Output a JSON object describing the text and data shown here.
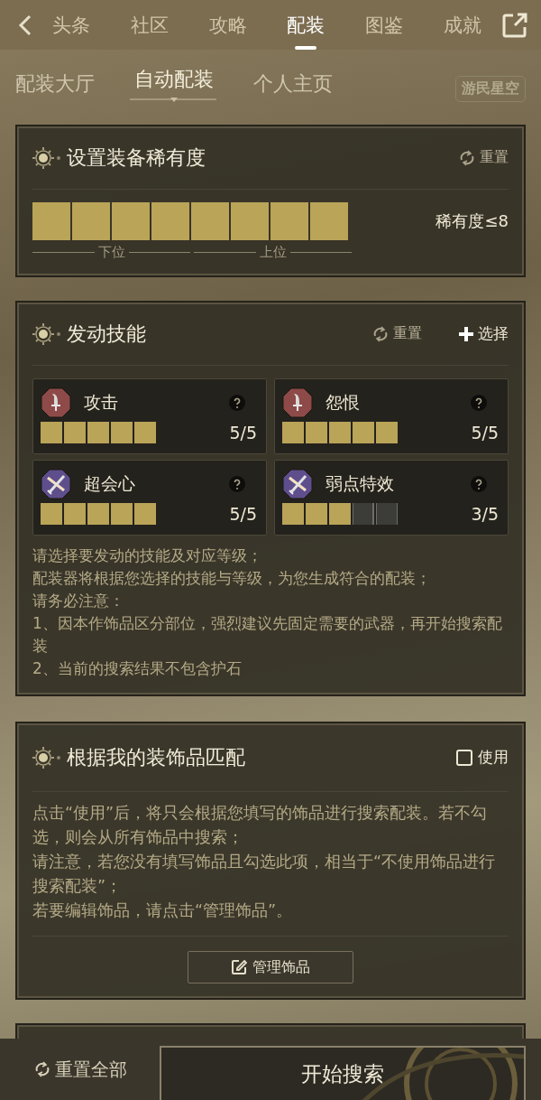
{
  "nav": {
    "tabs": [
      {
        "label": "头条",
        "selected": false
      },
      {
        "label": "社区",
        "selected": false
      },
      {
        "label": "攻略",
        "selected": false
      },
      {
        "label": "配装",
        "selected": true
      },
      {
        "label": "图鉴",
        "selected": false
      },
      {
        "label": "成就",
        "selected": false
      }
    ]
  },
  "subtabs": [
    {
      "label": "配装大厅",
      "selected": false
    },
    {
      "label": "自动配装",
      "selected": true
    },
    {
      "label": "个人主页",
      "selected": false
    }
  ],
  "brand": "游民星空",
  "rarity": {
    "title": "设置装备稀有度",
    "reset": "重置",
    "level": 1,
    "reading": "稀有度≤8",
    "scale": [
      "下位",
      "上位"
    ]
  },
  "skills": {
    "title": "发动技能",
    "reset": "重置",
    "select": "选择",
    "items": [
      {
        "name": "攻击",
        "kind": "blade",
        "color": "#8e4a48",
        "level": 1,
        "reading": "5/5"
      },
      {
        "name": "怨恨",
        "kind": "blade",
        "color": "#8e4a48",
        "level": 1,
        "reading": "5/5"
      },
      {
        "name": "超会心",
        "kind": "swords",
        "color": "#5f4e8c",
        "level": 1,
        "reading": "5/5"
      },
      {
        "name": "弱点特效",
        "kind": "swords",
        "color": "#5f4e8c",
        "level": 0.6,
        "reading": "3/5"
      }
    ],
    "notes": [
      "请选择要发动的技能及对应等级；",
      "配装器将根据您选择的技能与等级，为您生成符合的配装；",
      "请务必注意：",
      "1、因本作饰品区分部位，强烈建议先固定需要的武器，再开始搜索配装",
      "2、当前的搜索结果不包含护石"
    ]
  },
  "decorations": {
    "title": "根据我的装饰品匹配",
    "use": {
      "label": "使用",
      "checked": false
    },
    "notes": [
      "点击“使用”后，将只会根据您填写的饰品进行搜索配装。若不勾选，则会从所有饰品中搜索；",
      "请注意，若您没有填写饰品且勾选此项，相当于“不使用饰品进行搜索配装”；",
      "若要编辑饰品，请点击“管理饰品”。"
    ],
    "manage": "管理饰品"
  },
  "footer": {
    "reset_all": "重置全部",
    "search": "开始搜索"
  }
}
